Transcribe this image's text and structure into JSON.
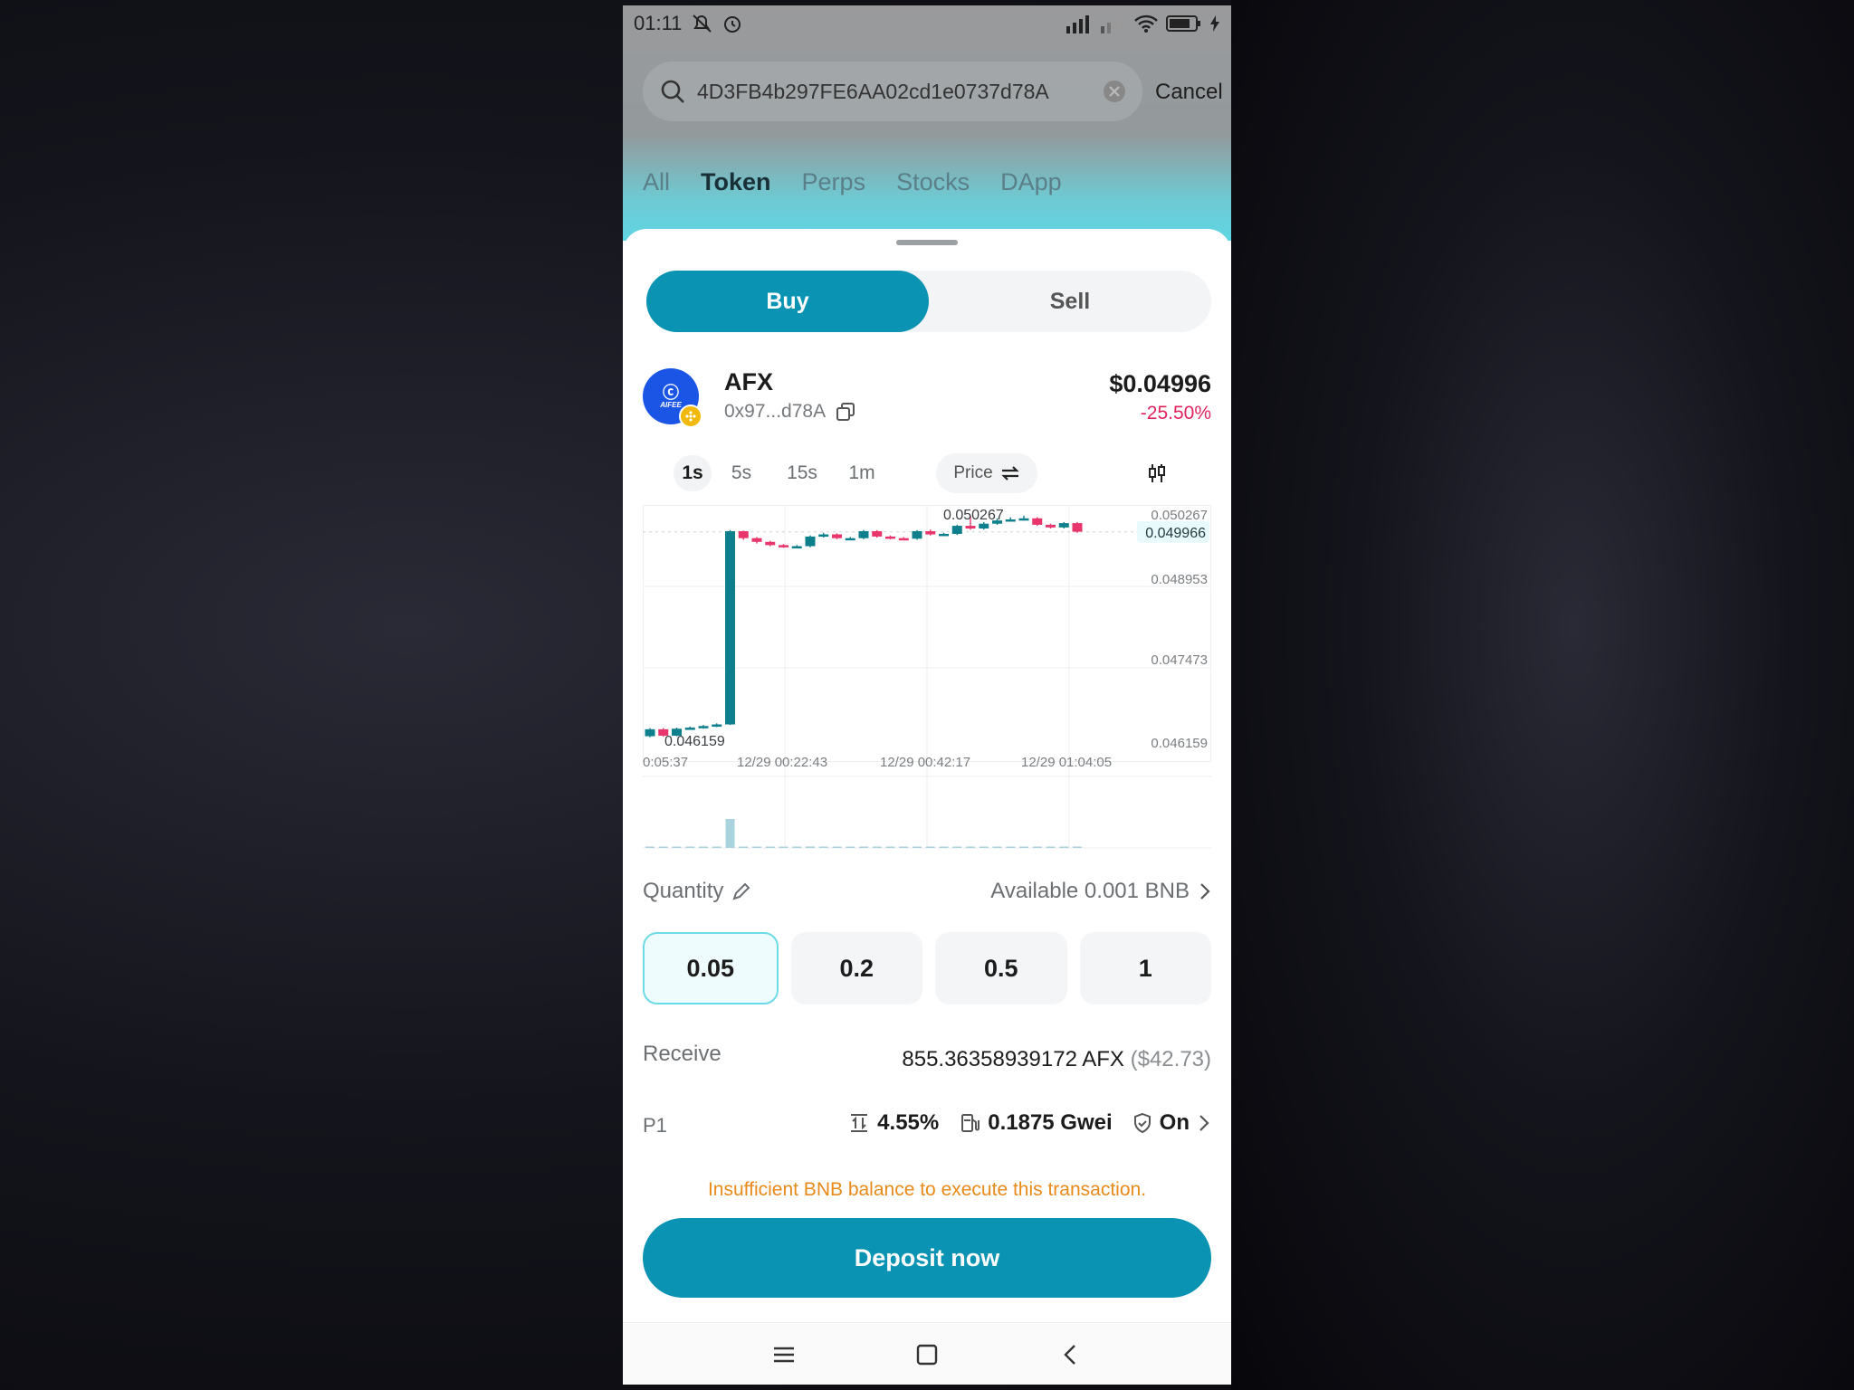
{
  "status_bar": {
    "time": "01:11"
  },
  "search": {
    "query": "4D3FB4b297FE6AA02cd1e0737d78A",
    "cancel_label": "Cancel"
  },
  "tabs": [
    {
      "label": "All",
      "active": false
    },
    {
      "label": "Token",
      "active": true
    },
    {
      "label": "Perps",
      "active": false
    },
    {
      "label": "Stocks",
      "active": false
    },
    {
      "label": "DApp",
      "active": false
    }
  ],
  "trade_toggle": {
    "buy_label": "Buy",
    "sell_label": "Sell",
    "selected": "Buy"
  },
  "token": {
    "logo_text": "AIFEE",
    "name": "AFX",
    "address": "0x97...d78A",
    "price": "$0.04996",
    "change": "-25.50%"
  },
  "intervals": [
    {
      "label": "1s",
      "active": true
    },
    {
      "label": "5s",
      "active": false
    },
    {
      "label": "15s",
      "active": false
    },
    {
      "label": "1m",
      "active": false
    }
  ],
  "price_toggle_label": "Price",
  "chart_data": {
    "type": "candlestick",
    "y_ticks": [
      "0.050267",
      "0.048953",
      "0.047473",
      "0.046159"
    ],
    "current_price_label": "0.049966",
    "high_label": "0.050267",
    "low_label": "0.046159",
    "x_ticks": [
      "0:05:37",
      "12/29 00:22:43",
      "12/29 00:42:17",
      "12/29 01:04:05"
    ],
    "ylim": [
      0.046159,
      0.050267
    ],
    "candles": [
      {
        "o": 0.04615,
        "c": 0.04628,
        "h": 0.0463,
        "l": 0.04613
      },
      {
        "o": 0.04628,
        "c": 0.04616,
        "h": 0.0463,
        "l": 0.04614
      },
      {
        "o": 0.04616,
        "c": 0.04629,
        "h": 0.04631,
        "l": 0.04615
      },
      {
        "o": 0.04629,
        "c": 0.04631,
        "h": 0.04633,
        "l": 0.04627
      },
      {
        "o": 0.04631,
        "c": 0.04634,
        "h": 0.04636,
        "l": 0.04629
      },
      {
        "o": 0.04634,
        "c": 0.04637,
        "h": 0.04639,
        "l": 0.04632
      },
      {
        "o": 0.04637,
        "c": 0.04998,
        "h": 0.05,
        "l": 0.04636
      },
      {
        "o": 0.04998,
        "c": 0.04985,
        "h": 0.04999,
        "l": 0.04982
      },
      {
        "o": 0.04985,
        "c": 0.04978,
        "h": 0.04987,
        "l": 0.04975
      },
      {
        "o": 0.04978,
        "c": 0.04972,
        "h": 0.0498,
        "l": 0.0497
      },
      {
        "o": 0.04972,
        "c": 0.04969,
        "h": 0.04974,
        "l": 0.04967
      },
      {
        "o": 0.04969,
        "c": 0.0497,
        "h": 0.04972,
        "l": 0.04967
      },
      {
        "o": 0.0497,
        "c": 0.04988,
        "h": 0.0499,
        "l": 0.04968
      },
      {
        "o": 0.04988,
        "c": 0.04992,
        "h": 0.04995,
        "l": 0.04986
      },
      {
        "o": 0.04992,
        "c": 0.04985,
        "h": 0.04994,
        "l": 0.04983
      },
      {
        "o": 0.04985,
        "c": 0.04985,
        "h": 0.04987,
        "l": 0.04983
      },
      {
        "o": 0.04985,
        "c": 0.04998,
        "h": 0.05,
        "l": 0.04983
      },
      {
        "o": 0.04998,
        "c": 0.04988,
        "h": 0.05,
        "l": 0.04986
      },
      {
        "o": 0.04988,
        "c": 0.04985,
        "h": 0.0499,
        "l": 0.04983
      },
      {
        "o": 0.04985,
        "c": 0.04984,
        "h": 0.04987,
        "l": 0.04982
      },
      {
        "o": 0.04984,
        "c": 0.04998,
        "h": 0.05,
        "l": 0.04982
      },
      {
        "o": 0.04998,
        "c": 0.04992,
        "h": 0.05001,
        "l": 0.0499
      },
      {
        "o": 0.04992,
        "c": 0.04993,
        "h": 0.04995,
        "l": 0.0499
      },
      {
        "o": 0.04993,
        "c": 0.05008,
        "h": 0.0501,
        "l": 0.04991
      },
      {
        "o": 0.05008,
        "c": 0.05003,
        "h": 0.05026,
        "l": 0.05001
      },
      {
        "o": 0.05003,
        "c": 0.05012,
        "h": 0.05015,
        "l": 0.05001
      },
      {
        "o": 0.05012,
        "c": 0.05018,
        "h": 0.05022,
        "l": 0.0501
      },
      {
        "o": 0.05018,
        "c": 0.0502,
        "h": 0.05024,
        "l": 0.05016
      },
      {
        "o": 0.0502,
        "c": 0.05022,
        "h": 0.05027,
        "l": 0.05018
      },
      {
        "o": 0.05022,
        "c": 0.0501,
        "h": 0.05024,
        "l": 0.05008
      },
      {
        "o": 0.0501,
        "c": 0.05005,
        "h": 0.05012,
        "l": 0.05003
      },
      {
        "o": 0.05005,
        "c": 0.05013,
        "h": 0.05015,
        "l": 0.05003
      },
      {
        "o": 0.05013,
        "c": 0.04997,
        "h": 0.05015,
        "l": 0.04995
      }
    ],
    "volumes": [
      0.02,
      0.02,
      0.02,
      0.02,
      0.02,
      0.02,
      1.0,
      0.03,
      0.02,
      0.02,
      0.02,
      0.02,
      0.05,
      0.02,
      0.02,
      0.02,
      0.02,
      0.02,
      0.02,
      0.02,
      0.02,
      0.02,
      0.02,
      0.03,
      0.02,
      0.02,
      0.02,
      0.02,
      0.02,
      0.02,
      0.02,
      0.02,
      0.02
    ],
    "colors": {
      "up": "#0e7f8c",
      "down": "#e8356b"
    }
  },
  "quantity": {
    "label": "Quantity",
    "available": "Available 0.001 BNB",
    "options": [
      "0.05",
      "0.2",
      "0.5",
      "1"
    ],
    "selected": "0.05"
  },
  "receive": {
    "label": "Receive",
    "amount": "855.36358939172 AFX",
    "usd": "($42.73)"
  },
  "settings": {
    "label": "P1",
    "slippage": "4.55%",
    "gas": "0.1875 Gwei",
    "protection": "On"
  },
  "warning": "Insufficient BNB balance to execute this transaction.",
  "deposit_label": "Deposit now",
  "colors": {
    "accent": "#0a93b3",
    "negative": "#e0245e",
    "warning": "#e88a1a"
  }
}
